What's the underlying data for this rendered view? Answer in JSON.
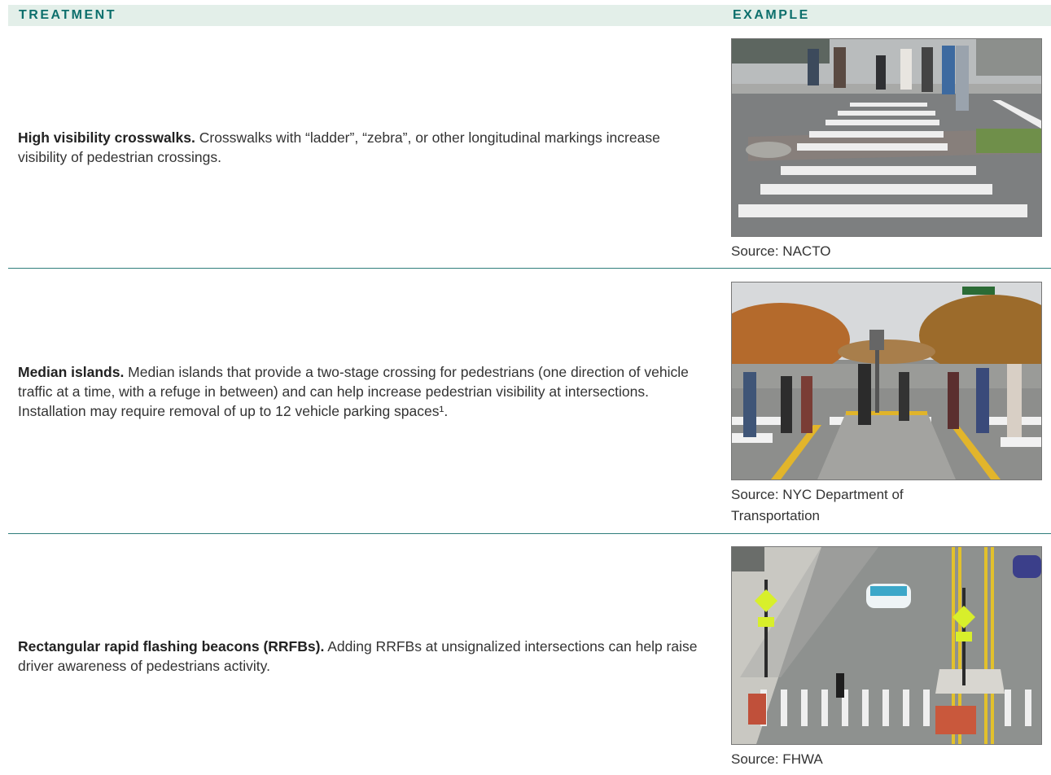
{
  "header": {
    "treatment_label": "TREATMENT",
    "example_label": "EXAMPLE"
  },
  "rows": [
    {
      "title": "High visibility crosswalks.",
      "text": " Crosswalks with “ladder”, “zebra”, or other longitudinal markings increase visibility of pedestrian crossings.",
      "source": "Source: NACTO"
    },
    {
      "title": "Median islands.",
      "text": " Median islands that provide a two-stage crossing for pedestrians (one direction of vehicle traffic at a time, with a refuge in between) and can help increase pedestrian visibility at intersections. Installation may require removal of up to 12 vehicle parking spaces¹.",
      "source": "Source: NYC Department of Transportation"
    },
    {
      "title": "Rectangular rapid flashing beacons (RRFBs).",
      "text": " Adding RRFBs at unsignalized intersections can help raise driver awareness of pedestrians activity.",
      "source": "Source: FHWA"
    }
  ],
  "colors": {
    "header_bg": "#e3efe9",
    "header_text": "#0d6f6c",
    "divider": "#2f7e7b"
  }
}
